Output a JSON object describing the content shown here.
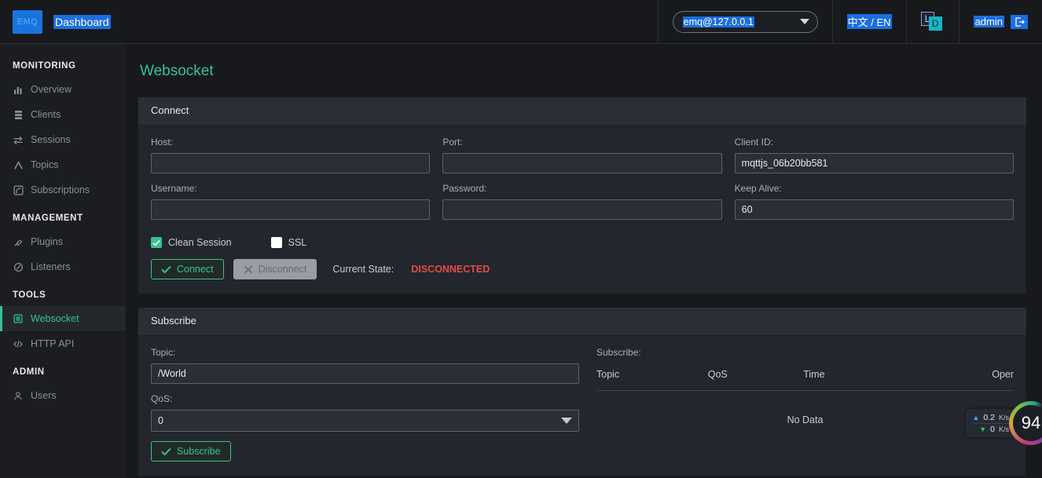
{
  "header": {
    "logo_text": "EMQ",
    "title": "Dashboard",
    "node_select": {
      "value": "emq@127.0.0.1",
      "icon": "chevron-down-icon"
    },
    "language_toggle": "中文 / EN",
    "theme_toggle": {
      "light": "L",
      "dark": "D"
    },
    "user": {
      "name": "admin",
      "logout_icon": "logout-icon"
    }
  },
  "sidebar": {
    "groups": [
      {
        "label": "MONITORING",
        "items": [
          {
            "label": "Overview",
            "icon": "bar-chart-icon",
            "active": false
          },
          {
            "label": "Clients",
            "icon": "server-icon",
            "active": false
          },
          {
            "label": "Sessions",
            "icon": "exchange-icon",
            "active": false
          },
          {
            "label": "Topics",
            "icon": "caret-up-icon",
            "active": false
          },
          {
            "label": "Subscriptions",
            "icon": "rss-icon",
            "active": false
          }
        ]
      },
      {
        "label": "MANAGEMENT",
        "items": [
          {
            "label": "Plugins",
            "icon": "plug-icon",
            "active": false
          },
          {
            "label": "Listeners",
            "icon": "circle-dash-icon",
            "active": false
          }
        ]
      },
      {
        "label": "TOOLS",
        "items": [
          {
            "label": "Websocket",
            "icon": "window-icon",
            "active": true
          },
          {
            "label": "HTTP API",
            "icon": "code-icon",
            "active": false
          }
        ]
      },
      {
        "label": "ADMIN",
        "items": [
          {
            "label": "Users",
            "icon": "user-icon",
            "active": false
          }
        ]
      }
    ]
  },
  "main": {
    "page_title": "Websocket",
    "connect": {
      "card_title": "Connect",
      "fields": {
        "host": {
          "label": "Host:",
          "value": "",
          "placeholder": ""
        },
        "port": {
          "label": "Port:",
          "value": "",
          "placeholder": ""
        },
        "client_id": {
          "label": "Client ID:",
          "value": "mqttjs_06b20bb581",
          "placeholder": ""
        },
        "username": {
          "label": "Username:",
          "value": "",
          "placeholder": ""
        },
        "password": {
          "label": "Password:",
          "value": "",
          "placeholder": ""
        },
        "keep_alive": {
          "label": "Keep Alive:",
          "value": "60",
          "placeholder": ""
        }
      },
      "checkboxes": {
        "clean_session": {
          "label": "Clean Session",
          "checked": true
        },
        "ssl": {
          "label": "SSL",
          "checked": false
        }
      },
      "connect_button": "Connect",
      "disconnect_button": "Disconnect",
      "state_label": "Current State:",
      "state_value": "DISCONNECTED"
    },
    "subscribe": {
      "card_title": "Subscribe",
      "topic": {
        "label": "Topic:",
        "value": "/World"
      },
      "qos": {
        "label": "QoS:",
        "value": "0"
      },
      "subscribe_button": "Subscribe",
      "table": {
        "caption": "Subscribe:",
        "columns": [
          "Topic",
          "QoS",
          "Time",
          "Oper"
        ],
        "empty_text": "No Data",
        "rows": []
      }
    }
  },
  "net_widget": {
    "upload": {
      "value": "0.2",
      "unit": "K/s"
    },
    "download": {
      "value": "0",
      "unit": "K/s"
    },
    "gauge_value": "94"
  },
  "colors": {
    "accent_green": "#34c38f",
    "danger_red": "#e24b4b",
    "selection_blue": "#1a6fe0",
    "page_bg": "#17191d",
    "card_bg": "#23262c"
  }
}
